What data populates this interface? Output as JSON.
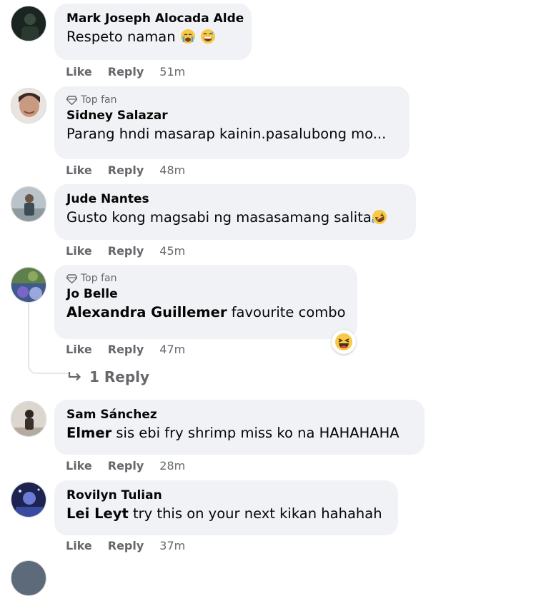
{
  "actions": {
    "like": "Like",
    "reply": "Reply"
  },
  "badge": {
    "top_fan_label": "Top fan",
    "icon": "diamond-icon"
  },
  "comments": [
    {
      "author": "Mark Joseph Alocada Alde",
      "text": "Respeto naman",
      "emojis": [
        "crying-face-emoji",
        "grinning-sweat-emoji"
      ],
      "time": "51m",
      "top_fan": false
    },
    {
      "author": "Sidney Salazar",
      "text": "Parang hndi masarap kainin.pasalubong mo...",
      "time": "48m",
      "top_fan": true
    },
    {
      "author": "Jude Nantes",
      "text": "Gusto kong magsabi ng masasamang salita",
      "emojis": [
        "rolling-laughing-emoji"
      ],
      "time": "45m",
      "top_fan": false
    },
    {
      "author": "Jo Belle",
      "tagged": "Alexandra Guillemer",
      "text": "favourite combo",
      "time": "47m",
      "top_fan": true,
      "reaction": "haha-reaction-icon",
      "replies": {
        "label": "1 Reply",
        "icon": "reply-arrow-icon"
      }
    },
    {
      "author": "Sam Sánchez",
      "tagged": "Elmer",
      "text": "sis ebi fry shrimp miss ko na HAHAHAHA",
      "time": "28m",
      "top_fan": false
    },
    {
      "author": "Rovilyn Tulian",
      "tagged": "Lei Leyt",
      "text": "try this on your next kikan hahahah",
      "time": "37m",
      "top_fan": false
    }
  ]
}
